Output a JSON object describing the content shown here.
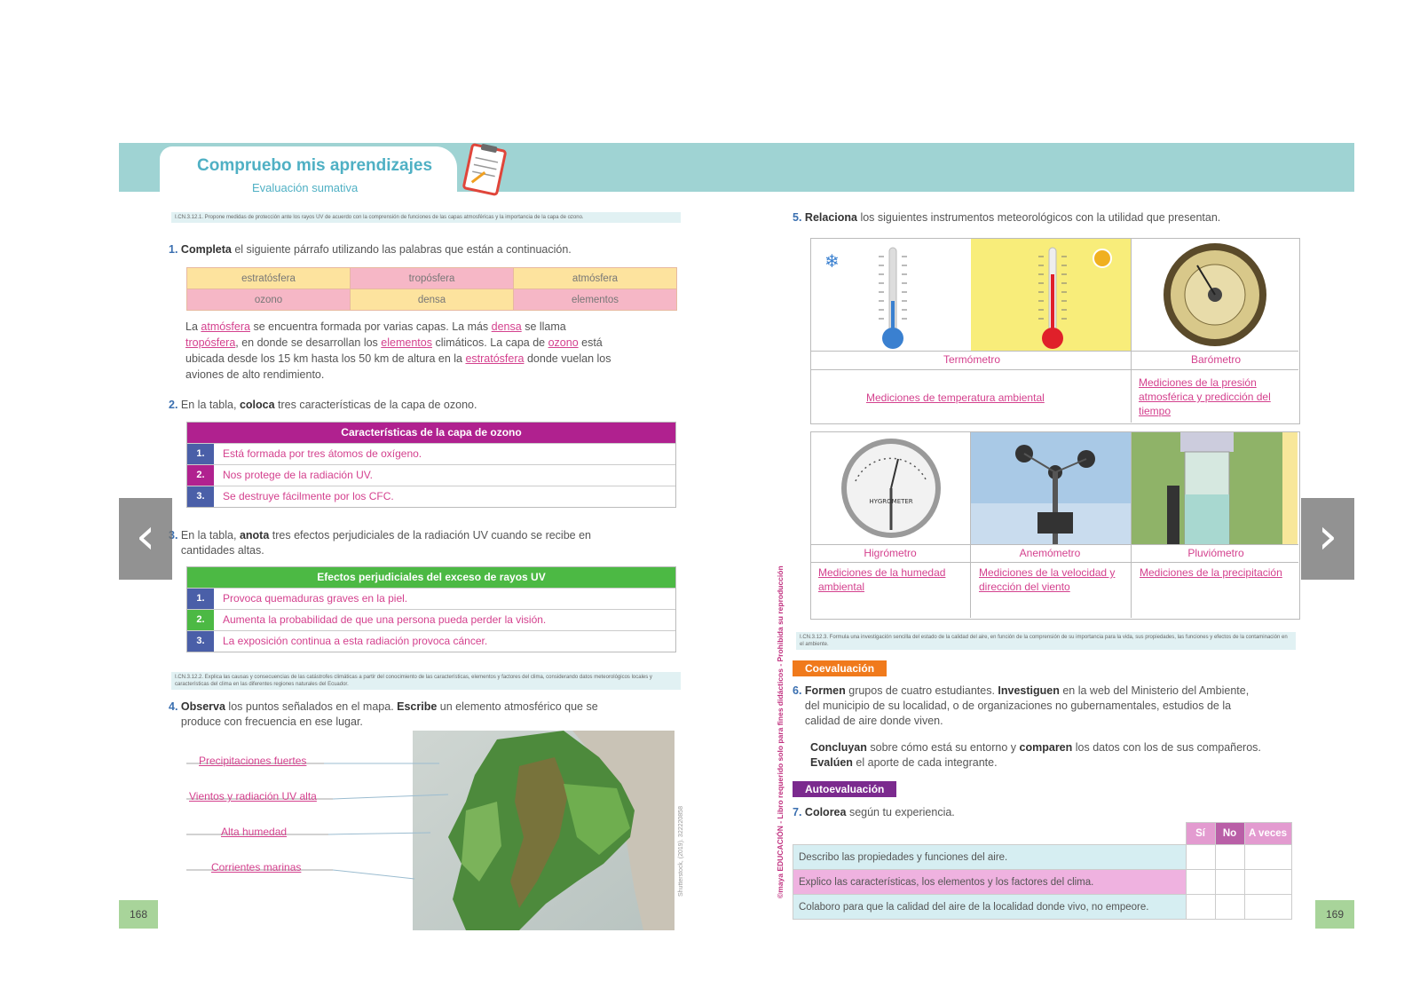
{
  "header": {
    "title": "Compruebo mis aprendizajes",
    "subtitle": "Evaluación sumativa"
  },
  "criteria": {
    "c1": "I.CN.3.12.1. Propone medidas de protección ante los rayos UV de acuerdo con la comprensión de funciones de las capas atmosféricas y la importancia de la capa de ozono.",
    "c2": "I.CN.3.12.2. Explica las causas y consecuencias de las catástrofes climáticas a partir del conocimiento de las características, elementos y factores del clima, considerando datos meteorológicos locales y características del clima en las diferentes regiones naturales del Ecuador.",
    "c3": "I.CN.3.12.3. Formula una investigación sencilla del estado de la calidad del aire, en función de la comprensión de su importancia para la vida, sus propiedades, las funciones y efectos de la contaminación en el ambiente."
  },
  "q1": {
    "num": "1.",
    "verb": "Completa",
    "text": " el siguiente párrafo utilizando las palabras que están a continuación.",
    "words": [
      "estratósfera",
      "tropósfera",
      "atmósfera",
      "ozono",
      "densa",
      "elementos"
    ],
    "paragraph": {
      "p1": "La ",
      "a1": "atmósfera",
      "p2": " se encuentra formada por varias capas. La más ",
      "a2": "densa",
      "p3": " se llama",
      "a3": "tropósfera",
      "p4": ", en donde se desarrollan los ",
      "a4": "elementos",
      "p5": " climáticos. La capa de ",
      "a5": "ozono",
      "p6": " está",
      "p7": "ubicada desde los 15 km hasta los 50 km de altura en la ",
      "a6": "estratósfera",
      "p8": " donde vuelan los",
      "p9": "aviones de alto rendimiento."
    }
  },
  "q2": {
    "num": "2.",
    "pre": "En la tabla, ",
    "verb": "coloca",
    "text": " tres características de la capa de ozono.",
    "header": "Características de la capa de ozono",
    "rows": [
      "Está formada por tres átomos de oxígeno.",
      "Nos protege de la radiación UV.",
      "Se destruye fácilmente por los CFC."
    ]
  },
  "q3": {
    "num": "3.",
    "pre": "En la tabla, ",
    "verb": "anota",
    "text": " tres efectos perjudiciales de la radiación UV cuando se recibe en",
    "text2": "cantidades altas.",
    "header": "Efectos perjudiciales del exceso de rayos UV",
    "rows": [
      "Provoca quemaduras graves en la piel.",
      "Aumenta la probabilidad de que una persona pueda perder la visión.",
      "La exposición continua a esta radiación provoca cáncer."
    ]
  },
  "q4": {
    "num": "4.",
    "verb": "Observa",
    "text": " los puntos señalados en el mapa. ",
    "verb2": "Escribe",
    "text2": " un elemento atmosférico que se",
    "text3": "produce con frecuencia en ese lugar.",
    "labels": [
      "Precipitaciones fuertes",
      "Vientos y radiación UV alta",
      "Alta humedad",
      "Corrientes marinas"
    ],
    "credit": "Shutterstock, (2019). 322220858"
  },
  "row_nums": [
    "1.",
    "2.",
    "3."
  ],
  "q5": {
    "num": "5.",
    "verb": "Relaciona",
    "text": " los siguientes instrumentos meteorológicos con la utilidad que presentan.",
    "instruments": [
      {
        "name": "Termómetro",
        "use": "Mediciones de temperatura ambiental"
      },
      {
        "name": "Barómetro",
        "use": "Mediciones de la presión atmosférica y predicción del tiempo"
      },
      {
        "name": "Higrómetro",
        "use": "Mediciones de la humedad ambiental"
      },
      {
        "name": "Anemómetro",
        "use": "Mediciones de la velocidad y dirección del viento"
      },
      {
        "name": "Pluviómetro",
        "use": "Mediciones de la precipitación"
      }
    ],
    "hygro_label": "HYGROMETER"
  },
  "coeval": {
    "tag": "Coevaluación",
    "num": "6.",
    "verb": "Formen",
    "t1": " grupos de cuatro estudiantes. ",
    "verb2": "Investiguen",
    "t2": " en la web del Ministerio del Ambiente,",
    "t3": "del municipio de su localidad, o de organizaciones no gubernamentales, estudios de la",
    "t4": "calidad de aire donde viven.",
    "verb3": "Concluyan",
    "t5": " sobre cómo está su entorno y ",
    "verb4": "comparen",
    "t6": " los datos con los de sus compañeros.",
    "verb5": "Evalúen",
    "t7": " el aporte de cada integrante."
  },
  "autoeval": {
    "tag": "Autoevaluación",
    "num": "7.",
    "verb": "Colorea",
    "text": " según tu experiencia.",
    "cols": [
      "Sí",
      "No",
      "A veces"
    ],
    "rows": [
      "Describo las propiedades y funciones del aire.",
      "Explico las características, los elementos y los factores del clima.",
      "Colaboro para que la calidad del aire de la localidad donde vivo, no empeore."
    ]
  },
  "side_text": "©maya EDUCACIÓN - Libro requerido solo para fines didácticos - Prohibida su reproducción",
  "pages": {
    "left": "168",
    "right": "169"
  },
  "nav": {
    "prev": "‹",
    "next": "›"
  },
  "colors": {
    "band": "#9fd3d3",
    "magenta": "#b0218f",
    "green": "#4cb944",
    "pink_text": "#d4418e",
    "orange": "#f07a1c",
    "purple": "#7b2a8e"
  }
}
